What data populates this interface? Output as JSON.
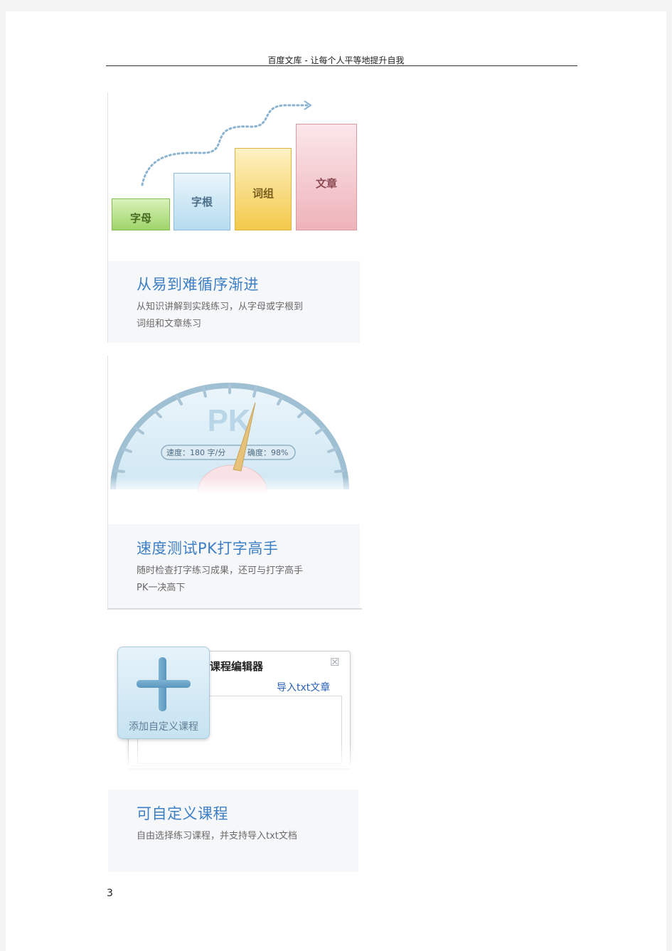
{
  "header": {
    "text": "百度文库 - 让每个人平等地提升自我"
  },
  "panels": {
    "progress": {
      "steps": [
        "字母",
        "字根",
        "词组",
        "文章"
      ],
      "title": "从易到难循序渐进",
      "desc_line1": "从知识讲解到实践练习，从字母或字根到",
      "desc_line2": "词组和文章练习"
    },
    "speed_test": {
      "gauge_logo": "PK",
      "speed_label": "速度：180 字/分",
      "accuracy_label": "确度：98%",
      "title": "速度测试PK打字高手",
      "desc_line1": "随时检查打字练习成果，还可与打字高手",
      "desc_line2": "PK一决高下"
    },
    "custom_course": {
      "add_label": "添加自定义课程",
      "editor_title": "课程编辑器",
      "import_link": "导入txt文章",
      "close_symbol": "☒",
      "title": "可自定义课程",
      "desc_line1": "自由选择练习课程，并支持导入txt文档"
    }
  },
  "page_number": "3"
}
